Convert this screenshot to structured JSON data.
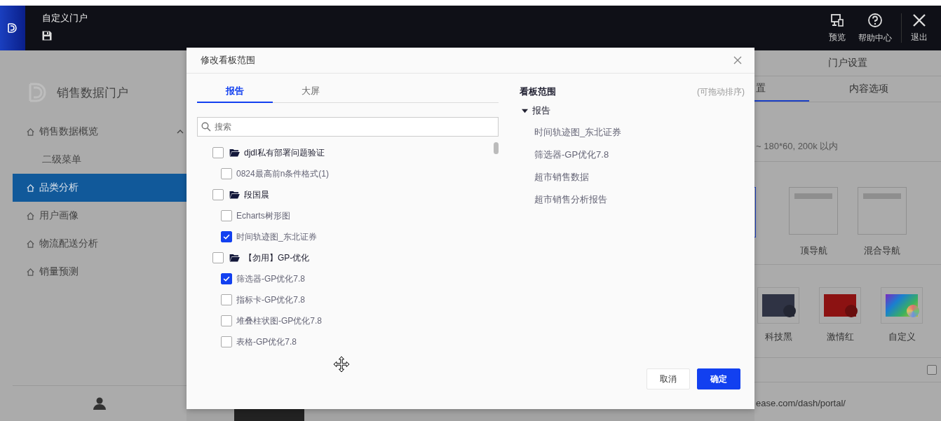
{
  "header": {
    "title": "自定义门户",
    "actions": [
      {
        "label": "预览",
        "kind": "preview"
      },
      {
        "label": "帮助中心",
        "kind": "help"
      },
      {
        "label": "退出",
        "kind": "exit"
      }
    ]
  },
  "sidebar": {
    "portal_name": "销售数据门户",
    "items": [
      {
        "label": "销售数据概览",
        "selected": false,
        "expanded": true,
        "children": [
          {
            "label": "二级菜单",
            "selected": false
          }
        ]
      },
      {
        "label": "品类分析",
        "selected": true
      },
      {
        "label": "用户画像",
        "selected": false
      },
      {
        "label": "物流配送分析",
        "selected": false
      },
      {
        "label": "销量预测",
        "selected": false
      }
    ]
  },
  "settings_panel": {
    "title": "门户设置",
    "tabs": [
      {
        "label": "置",
        "selected": true
      },
      {
        "label": "内容选项",
        "selected": false
      }
    ],
    "logo_hint": "~ 180*60, 200k 以内",
    "layouts": [
      {
        "selected": true
      },
      {
        "label": "顶导航",
        "selected": false
      },
      {
        "label": "混合导航",
        "selected": false
      }
    ],
    "themes": [
      {
        "label": "科技黑",
        "kind": "solid",
        "color": "#2f3344"
      },
      {
        "label": "激情红",
        "kind": "solid",
        "color": "#8c1212"
      },
      {
        "label": "自定义",
        "kind": "rainbow"
      }
    ],
    "option_checked": false,
    "url_text": "ease.com/dash/portal/"
  },
  "dialog": {
    "title": "修改看板范围",
    "tabs": [
      {
        "label": "报告",
        "selected": true
      },
      {
        "label": "大屏",
        "selected": false
      }
    ],
    "search_placeholder": "搜索",
    "tree": [
      {
        "label": "djdl私有部署问题验证",
        "kind": "folder",
        "checked": false,
        "children": [
          {
            "label": "0824最高前n条件格式(1)",
            "kind": "report",
            "checked": false
          }
        ]
      },
      {
        "label": "段国晨",
        "kind": "folder",
        "checked": false,
        "children": [
          {
            "label": "Echarts树形图",
            "kind": "report",
            "checked": false
          },
          {
            "label": "时间轨迹图_东北证券",
            "kind": "report",
            "checked": true
          }
        ]
      },
      {
        "label": "【勿用】GP-优化",
        "kind": "folder",
        "checked": false,
        "children": [
          {
            "label": "筛选器-GP优化7.8",
            "kind": "report",
            "checked": true
          },
          {
            "label": "指标卡-GP优化7.8",
            "kind": "report",
            "checked": false
          },
          {
            "label": "堆叠柱状图-GP优化7.8",
            "kind": "report",
            "checked": false
          },
          {
            "label": "表格-GP优化7.8",
            "kind": "report",
            "checked": false
          }
        ]
      }
    ],
    "scope_title": "看板范围",
    "scope_hint": "(可拖动排序)",
    "scope_groups": [
      {
        "label": "报告",
        "expanded": true,
        "items": [
          "时间轨迹图_东北证券",
          "筛选器-GP优化7.8",
          "超市销售数据",
          "超市销售分析报告"
        ]
      }
    ],
    "buttons": [
      {
        "label": "取消",
        "kind": "secondary"
      },
      {
        "label": "确定",
        "kind": "primary"
      }
    ]
  }
}
